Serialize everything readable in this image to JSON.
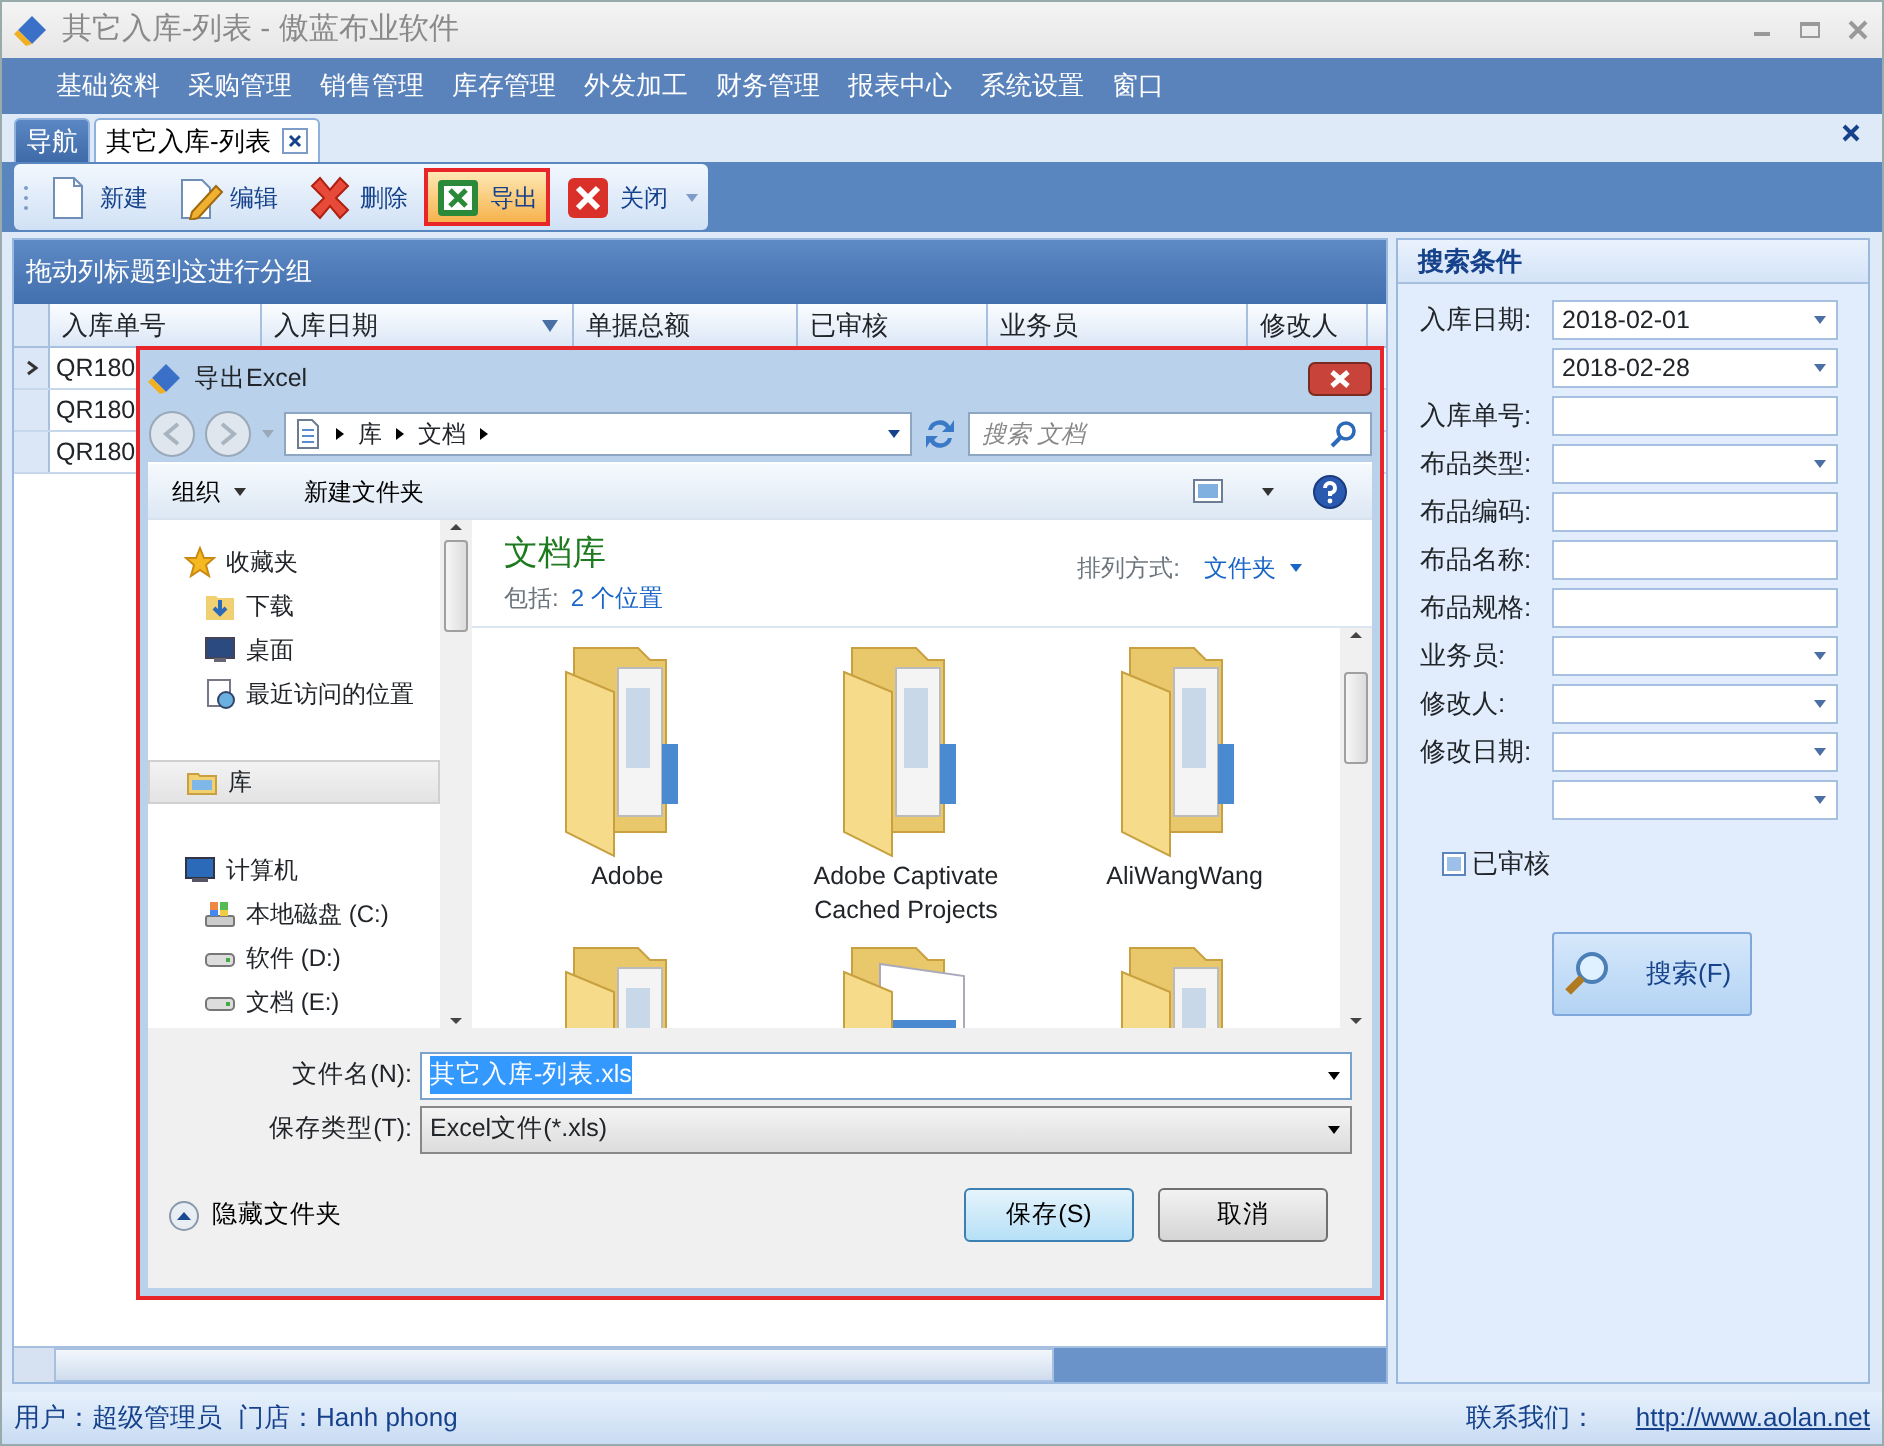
{
  "window": {
    "title": "其它入库-列表 - 傲蓝布业软件"
  },
  "menu": [
    "基础资料",
    "采购管理",
    "销售管理",
    "库存管理",
    "外发加工",
    "财务管理",
    "报表中心",
    "系统设置",
    "窗口"
  ],
  "tabs": [
    {
      "label": "导航",
      "selected": false,
      "closable": false
    },
    {
      "label": "其它入库-列表",
      "selected": true,
      "closable": true
    }
  ],
  "toolbar": [
    {
      "kind": "new",
      "label": "新建",
      "highlighted": false,
      "outlined": false
    },
    {
      "kind": "edit",
      "label": "编辑",
      "highlighted": false,
      "outlined": false
    },
    {
      "kind": "delete",
      "label": "删除",
      "highlighted": false,
      "outlined": false
    },
    {
      "kind": "export",
      "label": "导出",
      "highlighted": true,
      "outlined": true
    },
    {
      "kind": "close",
      "label": "关闭",
      "highlighted": false,
      "outlined": false
    }
  ],
  "grid": {
    "group_hint": "拖动列标题到这进行分组",
    "columns": [
      {
        "label": "入库单号",
        "sorted": false
      },
      {
        "label": "入库日期",
        "sorted": true
      },
      {
        "label": "单据总额",
        "sorted": false
      },
      {
        "label": "已审核",
        "sorted": false
      },
      {
        "label": "业务员",
        "sorted": false
      },
      {
        "label": "修改人",
        "sorted": false
      }
    ],
    "rows": [
      {
        "selected": true,
        "cells": [
          "QR180"
        ]
      },
      {
        "selected": false,
        "cells": [
          "QR180"
        ]
      },
      {
        "selected": false,
        "cells": [
          "QR180"
        ]
      }
    ]
  },
  "search_panel": {
    "title": "搜索条件",
    "fields": [
      {
        "label": "入库日期:",
        "kind": "select",
        "value": "2018-02-01"
      },
      {
        "kind": "select",
        "value": "2018-02-28"
      },
      {
        "label": "入库单号:",
        "kind": "text"
      },
      {
        "label": "布品类型:",
        "kind": "select"
      },
      {
        "label": "布品编码:",
        "kind": "text"
      },
      {
        "label": "布品名称:",
        "kind": "text"
      },
      {
        "label": "布品规格:",
        "kind": "text"
      },
      {
        "label": "业务员:",
        "kind": "select"
      },
      {
        "label": "修改人:",
        "kind": "select"
      },
      {
        "label": "修改日期:",
        "kind": "select"
      },
      {
        "kind": "select"
      }
    ],
    "checkbox": {
      "label": "已审核",
      "checked": false
    },
    "button": "搜索(F)"
  },
  "dialog": {
    "title": "导出Excel",
    "outlined": true,
    "breadcrumb": [
      "库",
      "文档"
    ],
    "search_placeholder": "搜索 文档",
    "toolbar": [
      "组织",
      "新建文件夹"
    ],
    "nav": [
      {
        "label": "收藏夹",
        "kind": "star",
        "selected": false,
        "children": [
          {
            "label": "下载",
            "kind": "download",
            "selected": false
          },
          {
            "label": "桌面",
            "kind": "desktop",
            "selected": false
          },
          {
            "label": "最近访问的位置",
            "kind": "recent",
            "selected": false
          }
        ]
      },
      {
        "label": "库",
        "kind": "library",
        "selected": true
      },
      {
        "label": "计算机",
        "kind": "computer",
        "selected": false,
        "children": [
          {
            "label": "本地磁盘 (C:)",
            "kind": "system-drive",
            "selected": false
          },
          {
            "label": "软件 (D:)",
            "kind": "drive",
            "selected": false
          },
          {
            "label": "文档 (E:)",
            "kind": "drive",
            "selected": false
          }
        ]
      }
    ],
    "library_title": "文档库",
    "includes_label": "包括:",
    "includes_link": "2 个位置",
    "sort_label": "排列方式:",
    "sort_value": "文件夹",
    "items": [
      {
        "label": "Adobe",
        "kind": "folder"
      },
      {
        "label": "Adobe Captivate Cached Projects",
        "kind": "folder"
      },
      {
        "label": "AliWangWang",
        "kind": "folder"
      },
      {
        "kind": "folder"
      },
      {
        "kind": "document-folder"
      },
      {
        "kind": "folder"
      }
    ],
    "file_name_label": "文件名(N):",
    "file_name": "其它入库-列表.xls",
    "file_type_label": "保存类型(T):",
    "file_type": "Excel文件(*.xls)",
    "hide_folders": "隐藏文件夹",
    "buttons": [
      {
        "label": "保存(S)",
        "default": true
      },
      {
        "label": "取消",
        "default": false
      }
    ]
  },
  "status_bar": {
    "user": "用户：超级管理员",
    "store": "门店：Hanh phong",
    "contact_label": "联系我们：",
    "contact_link": "http://www.aolan.net"
  }
}
